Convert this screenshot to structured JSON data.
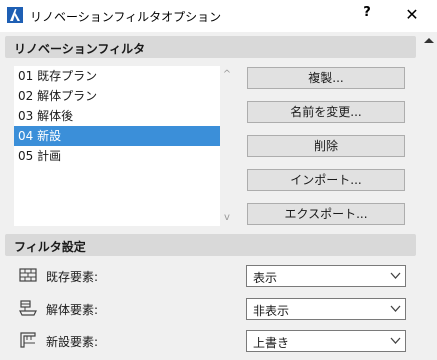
{
  "window": {
    "title": "リノベーションフィルタオプション",
    "help_label": "?",
    "close_label": "✕"
  },
  "filters_section": {
    "header": "リノベーションフィルタ",
    "items": [
      {
        "label": "01 既存プラン",
        "selected": false
      },
      {
        "label": "02 解体プラン",
        "selected": false
      },
      {
        "label": "03 解体後",
        "selected": false
      },
      {
        "label": "04 新設",
        "selected": true
      },
      {
        "label": "05 計画",
        "selected": false
      }
    ],
    "buttons": {
      "duplicate": "複製...",
      "rename": "名前を変更...",
      "delete": "削除",
      "import": "インポート...",
      "export": "エクスポート..."
    }
  },
  "settings_section": {
    "header": "フィルタ設定",
    "rows": [
      {
        "label": "既存要素:",
        "value": "表示",
        "icon": "brick-wall-icon"
      },
      {
        "label": "解体要素:",
        "value": "非表示",
        "icon": "demolish-icon"
      },
      {
        "label": "新設要素:",
        "value": "上書き",
        "icon": "new-construction-icon"
      }
    ]
  },
  "colors": {
    "selection": "#3b8fd9",
    "section_header": "#d9d9d9",
    "dialog_bg": "#f0f0f0",
    "button_bg": "#e1e1e1"
  }
}
